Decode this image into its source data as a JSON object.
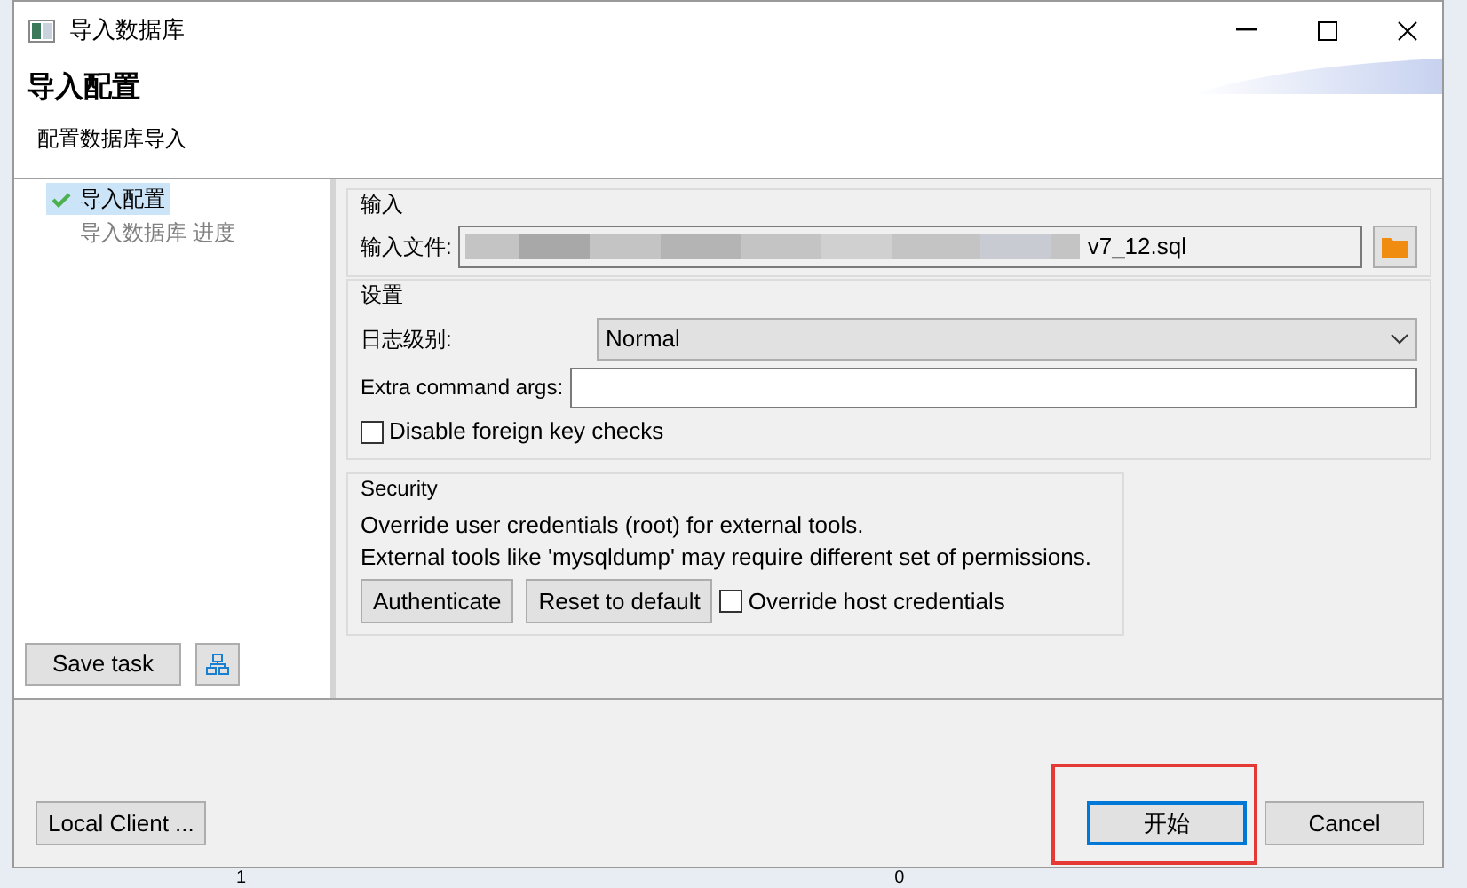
{
  "window": {
    "title": "导入数据库"
  },
  "header": {
    "title": "导入配置",
    "subtitle": "配置数据库导入"
  },
  "steps": [
    {
      "label": "导入配置",
      "selected": true,
      "done": true
    },
    {
      "label": "导入数据库 进度",
      "selected": false,
      "done": false
    }
  ],
  "save_task": {
    "label": "Save task"
  },
  "input_group": {
    "title": "输入",
    "file_label": "输入文件:",
    "file_value": "v7_12.sql"
  },
  "settings_group": {
    "title": "设置",
    "log_level_label": "日志级别:",
    "log_level": "Normal",
    "extra_args_label": "Extra command args:",
    "disable_fk": {
      "label": "Disable foreign key checks",
      "checked": false
    }
  },
  "security_group": {
    "title": "Security",
    "lines": [
      "Override user credentials (root) for external tools.",
      "External tools like 'mysqldump' may require different set of permissions."
    ],
    "buttons": [
      "Authenticate",
      "Reset to default"
    ],
    "override_host": {
      "label": "Override host credentials",
      "checked": false
    }
  },
  "footer": {
    "left_button": "Local Client ...",
    "buttons": [
      {
        "label": "开始",
        "default": true,
        "highlighted": true
      },
      {
        "label": "Cancel",
        "default": false,
        "highlighted": false
      }
    ]
  },
  "background_values": [
    "1",
    "0"
  ]
}
